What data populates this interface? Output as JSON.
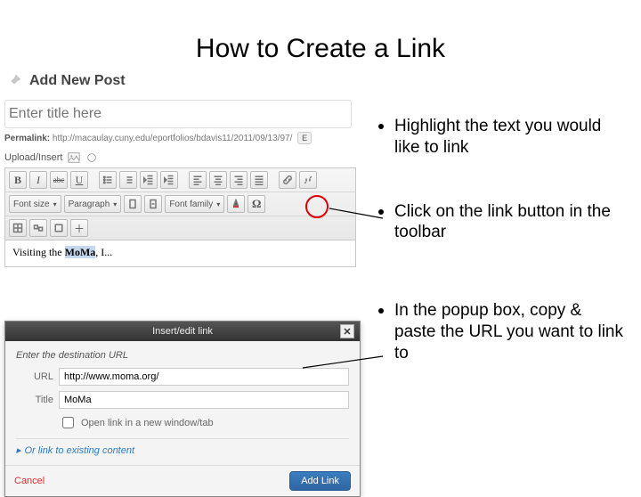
{
  "slide": {
    "title": "How to Create a Link"
  },
  "bullets": [
    "Highlight the text you would like to link",
    "Click on the link button in the toolbar",
    "In the popup box, copy & paste the URL you want to link to"
  ],
  "editor": {
    "add_new_post": "Add New Post",
    "title_placeholder": "Enter title here",
    "permalink_label": "Permalink:",
    "permalink_url": "http://macaulay.cuny.edu/eportfolios/bdavis11/2011/09/13/97/",
    "permalink_edit": "E",
    "upload_label": "Upload/Insert",
    "toolbar": {
      "row1": {
        "bold": "B",
        "italic": "I",
        "strike": "abc",
        "underline": "U"
      },
      "row2": {
        "font_size": "Font size",
        "paragraph": "Paragraph",
        "font_family": "Font family"
      }
    },
    "content": {
      "prefix": "Visiting the ",
      "highlighted": "MoMa",
      "suffix": ", I..."
    }
  },
  "modal": {
    "title": "Insert/edit link",
    "header": "Enter the destination URL",
    "url_label": "URL",
    "url_value": "http://www.moma.org/",
    "title_label": "Title",
    "title_value": "MoMa",
    "newtab_label": "Open link in a new window/tab",
    "existing_link": "Or link to existing content",
    "cancel": "Cancel",
    "add_link": "Add Link"
  }
}
